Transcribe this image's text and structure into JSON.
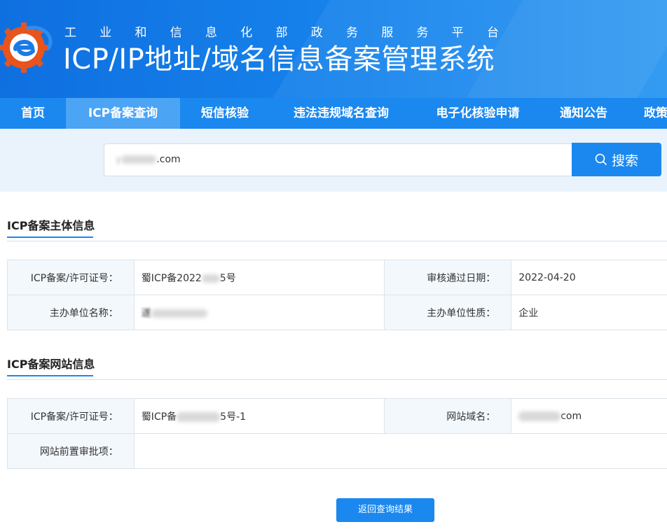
{
  "header": {
    "subtitle_chars": [
      "工",
      "业",
      "和",
      "信",
      "息",
      "化",
      "部",
      "政",
      "务",
      "服",
      "务",
      "平",
      "台"
    ],
    "title": "ICP/IP地址/域名信息备案管理系统",
    "brand_color": "#0f6fe0"
  },
  "nav": {
    "items": [
      {
        "label": "首页"
      },
      {
        "label": "ICP备案查询",
        "active": true
      },
      {
        "label": "短信核验"
      },
      {
        "label": "违法违规域名查询"
      },
      {
        "label": "电子化核验申请"
      },
      {
        "label": "通知公告"
      },
      {
        "label": "政策"
      }
    ]
  },
  "search": {
    "value_prefix": "y",
    "value_suffix": ".com",
    "button_label": "搜索",
    "button_icon": "search-icon"
  },
  "sections": {
    "subject": {
      "title": "ICP备案主体信息",
      "license_label": "ICP备案/许可证号：",
      "license_prefix": "蜀ICP备2022",
      "license_suffix": "5号",
      "date_label": "审核通过日期：",
      "date_value": "2022-04-20",
      "org_name_label": "主办单位名称：",
      "org_name_prefix": "遂",
      "org_type_label": "主办单位性质：",
      "org_type_value": "企业"
    },
    "website": {
      "title": "ICP备案网站信息",
      "license_label": "ICP备案/许可证号：",
      "license_prefix": "蜀ICP备",
      "license_suffix": "5号-1",
      "domain_label": "网站域名：",
      "domain_suffix": "com",
      "approval_label": "网站前置审批项：",
      "approval_value": ""
    }
  },
  "actions": {
    "back_label": "返回查询结果"
  }
}
